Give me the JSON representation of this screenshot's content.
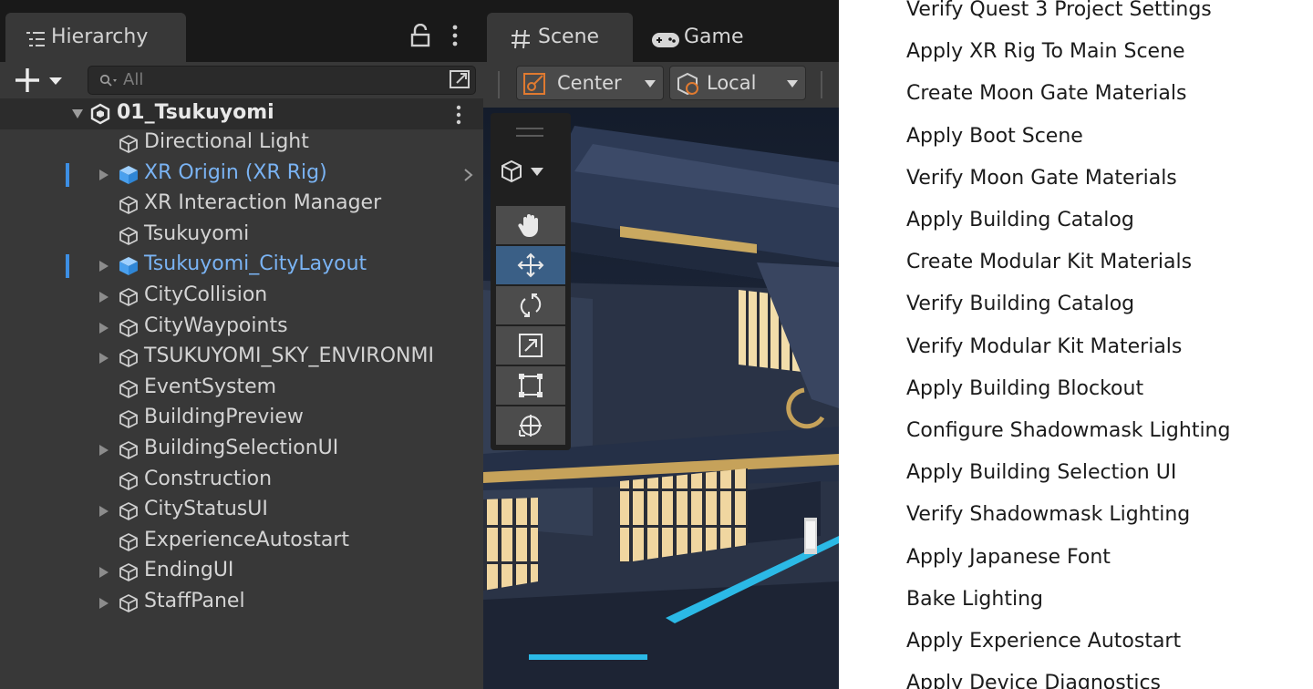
{
  "hierarchy": {
    "tab_label": "Hierarchy",
    "search_placeholder": "All",
    "scene_name": "01_Tsukuyomi",
    "items": [
      {
        "label": "Directional Light",
        "expandable": false,
        "highlighted": false,
        "prefab": false
      },
      {
        "label": "XR Origin (XR Rig)",
        "expandable": true,
        "highlighted": true,
        "prefab": true
      },
      {
        "label": "XR Interaction Manager",
        "expandable": false,
        "highlighted": false,
        "prefab": false
      },
      {
        "label": "Tsukuyomi",
        "expandable": false,
        "highlighted": false,
        "prefab": false
      },
      {
        "label": "Tsukuyomi_CityLayout",
        "expandable": true,
        "highlighted": true,
        "prefab": true
      },
      {
        "label": "CityCollision",
        "expandable": true,
        "highlighted": false,
        "prefab": false
      },
      {
        "label": "CityWaypoints",
        "expandable": true,
        "highlighted": false,
        "prefab": false
      },
      {
        "label": "TSUKUYOMI_SKY_ENVIRONMI",
        "expandable": true,
        "highlighted": false,
        "prefab": false
      },
      {
        "label": "EventSystem",
        "expandable": false,
        "highlighted": false,
        "prefab": false
      },
      {
        "label": "BuildingPreview",
        "expandable": false,
        "highlighted": false,
        "prefab": false
      },
      {
        "label": "BuildingSelectionUI",
        "expandable": true,
        "highlighted": false,
        "prefab": false
      },
      {
        "label": "Construction",
        "expandable": false,
        "highlighted": false,
        "prefab": false
      },
      {
        "label": "CityStatusUI",
        "expandable": true,
        "highlighted": false,
        "prefab": false
      },
      {
        "label": "ExperienceAutostart",
        "expandable": false,
        "highlighted": false,
        "prefab": false
      },
      {
        "label": "EndingUI",
        "expandable": true,
        "highlighted": false,
        "prefab": false
      },
      {
        "label": "StaffPanel",
        "expandable": true,
        "highlighted": false,
        "prefab": false
      }
    ]
  },
  "scene_view": {
    "tabs": [
      {
        "label": "Scene",
        "icon": "hash-icon",
        "active": true
      },
      {
        "label": "Game",
        "icon": "gamepad-icon",
        "active": false
      }
    ],
    "pivot_mode": "Center",
    "pivot_space": "Local",
    "tools": [
      "hand-tool-icon",
      "move-tool-icon",
      "rotate-tool-icon",
      "scale-tool-icon",
      "rect-tool-icon",
      "transform-tool-icon"
    ],
    "active_tool": "move-tool-icon"
  },
  "menu": {
    "items": [
      "Verify Quest 3 Project Settings",
      "Apply XR Rig To Main Scene",
      "Create Moon Gate Materials",
      "Apply Boot Scene",
      "Verify Moon Gate Materials",
      "Apply Building Catalog",
      "Create Modular Kit Materials",
      "Verify Building Catalog",
      "Verify Modular Kit Materials",
      "Apply Building Blockout",
      "Configure Shadowmask Lighting",
      "Apply Building Selection UI",
      "Verify Shadowmask Lighting",
      "Apply Japanese Font",
      "Bake Lighting",
      "Apply Experience Autostart",
      "Apply Device Diagnostics"
    ]
  },
  "colors": {
    "panel_bg": "#383838",
    "tab_strip": "#191919",
    "prefab_blue": "#7ab3f3",
    "selection_bar": "#3d8fe4",
    "active_tool": "#3a5f86"
  }
}
